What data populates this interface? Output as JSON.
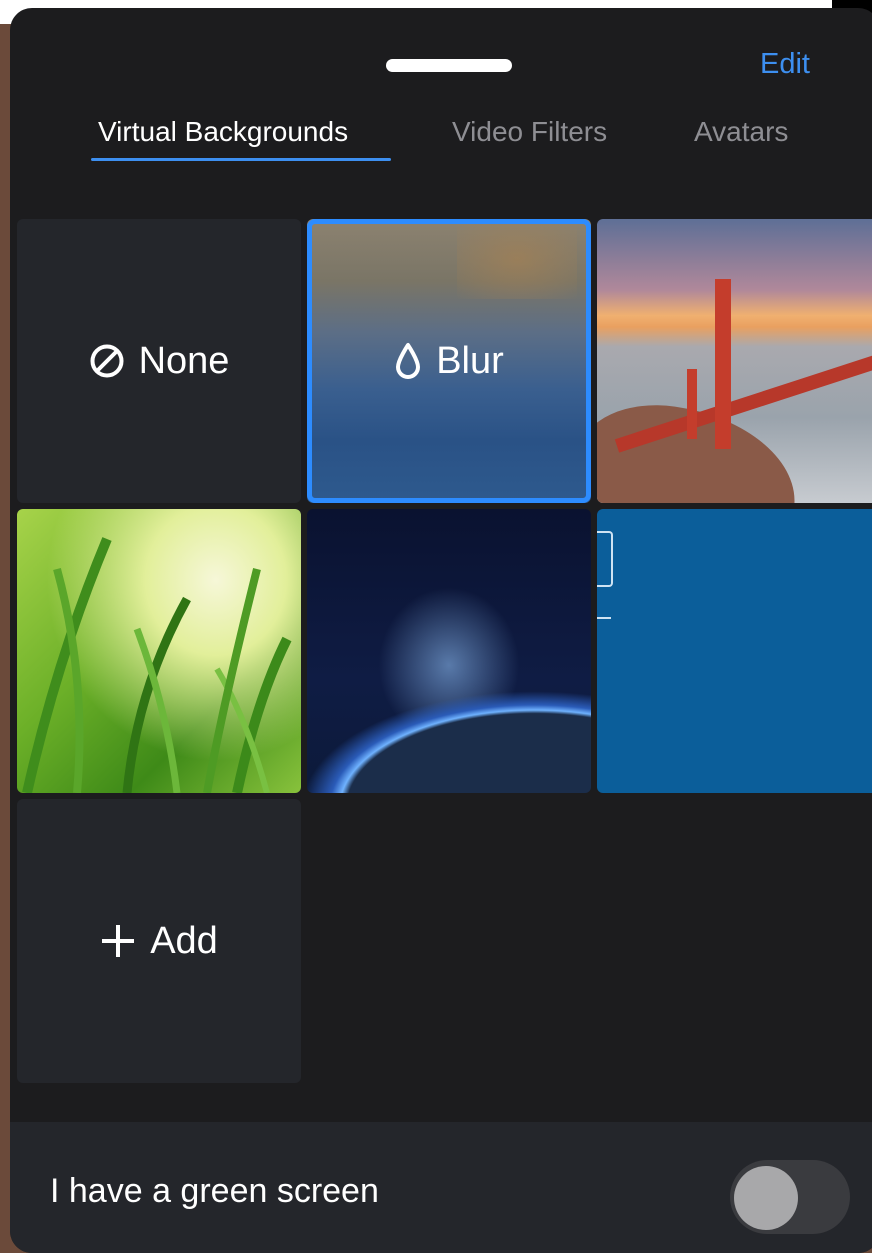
{
  "header": {
    "edit_label": "Edit"
  },
  "tabs": [
    {
      "label": "Virtual Backgrounds",
      "active": true
    },
    {
      "label": "Video Filters",
      "active": false
    },
    {
      "label": "Avatars",
      "active": false
    }
  ],
  "backgrounds": {
    "none_label": "None",
    "blur_label": "Blur",
    "add_label": "Add",
    "selected": "Blur",
    "images": [
      "golden-gate-bridge",
      "green-grass",
      "earth-from-space",
      "blue-slide"
    ]
  },
  "footer": {
    "green_screen_label": "I have a green screen",
    "green_screen_enabled": false
  },
  "colors": {
    "accent": "#3d8ff0",
    "selection_ring": "#2d8cff",
    "sheet_bg": "#1c1c1e",
    "tile_bg": "#24262b"
  }
}
